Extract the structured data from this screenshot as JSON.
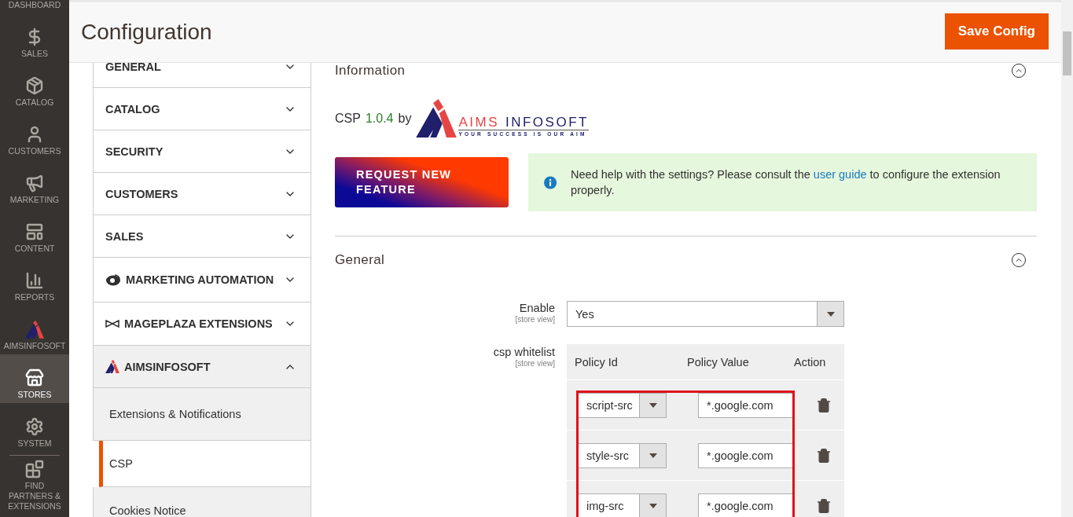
{
  "sidebar": {
    "items": [
      {
        "label": "DASHBOARD",
        "kind": "dashboard",
        "selected": false
      },
      {
        "label": "SALES",
        "kind": "sales",
        "selected": false
      },
      {
        "label": "CATALOG",
        "kind": "catalog",
        "selected": false
      },
      {
        "label": "CUSTOMERS",
        "kind": "customers",
        "selected": false
      },
      {
        "label": "MARKETING",
        "kind": "marketing",
        "selected": false
      },
      {
        "label": "CONTENT",
        "kind": "content",
        "selected": false
      },
      {
        "label": "REPORTS",
        "kind": "reports",
        "selected": false
      },
      {
        "label": "AIMSINFOSOFT",
        "kind": "aims",
        "selected": false
      },
      {
        "label": "STORES",
        "kind": "stores",
        "selected": true
      },
      {
        "label": "SYSTEM",
        "kind": "system",
        "selected": false
      },
      {
        "label": "FIND PARTNERS & EXTENSIONS",
        "kind": "partners",
        "selected": false
      }
    ]
  },
  "header": {
    "title": "Configuration",
    "save_button": "Save Config"
  },
  "config_nav": {
    "items": [
      {
        "label": "GENERAL",
        "kind": "plain",
        "expanded": false
      },
      {
        "label": "CATALOG",
        "kind": "plain",
        "expanded": false
      },
      {
        "label": "SECURITY",
        "kind": "plain",
        "expanded": false
      },
      {
        "label": "CUSTOMERS",
        "kind": "plain",
        "expanded": false
      },
      {
        "label": "SALES",
        "kind": "plain",
        "expanded": false
      },
      {
        "label": "MARKETING AUTOMATION",
        "kind": "cloud",
        "expanded": false
      },
      {
        "label": "MAGEPLAZA EXTENSIONS",
        "kind": "mageplaza",
        "expanded": false
      },
      {
        "label": "AIMSINFOSOFT",
        "kind": "aims",
        "expanded": true,
        "children": [
          {
            "label": "Extensions & Notifications",
            "selected": false
          },
          {
            "label": "CSP",
            "selected": true
          },
          {
            "label": "Cookies Notice",
            "selected": false
          }
        ]
      }
    ]
  },
  "information": {
    "heading": "Information",
    "expanded": true,
    "product": "CSP",
    "version": "1.0.4",
    "by": "by",
    "logo": {
      "word_1": "AIMS",
      "word_2": "INFOSOFT",
      "tagline": "YOUR SUCCESS IS OUR AIM"
    },
    "request_button": "REQUEST NEW FEATURE",
    "notice": {
      "text": "Need help with the settings? Please consult the",
      "link": "user guide",
      "text_after": "to configure the extension properly."
    }
  },
  "general": {
    "heading": "General",
    "expanded": true,
    "enable": {
      "label": "Enable",
      "scope": "[store view]",
      "value": "Yes"
    },
    "whitelist": {
      "label": "csp whitelist",
      "scope": "[store view]",
      "columns": [
        "Policy Id",
        "Policy Value",
        "Action"
      ],
      "rows": [
        {
          "policy_id": "script-src",
          "policy_value": "*.google.com"
        },
        {
          "policy_id": "style-src",
          "policy_value": "*.google.com"
        },
        {
          "policy_id": "img-src",
          "policy_value": "*.google.com"
        }
      ]
    }
  }
}
